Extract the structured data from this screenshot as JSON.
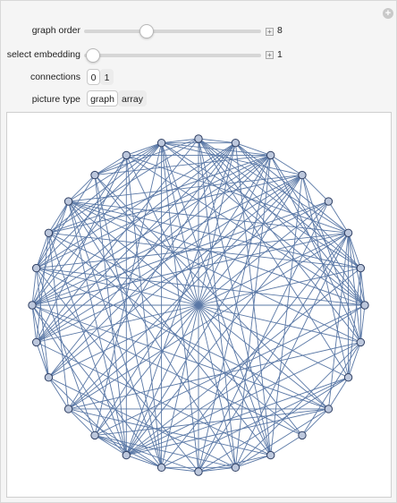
{
  "controls": {
    "graph_order": {
      "label": "graph order",
      "value": "8",
      "fraction": 0.43
    },
    "select_embedding": {
      "label": "select embedding",
      "value": "1",
      "fraction": 0.0
    },
    "connections": {
      "label": "connections",
      "options": [
        "0",
        "1"
      ],
      "selected": "0"
    },
    "picture_type": {
      "label": "picture type",
      "options": [
        "graph",
        "array"
      ],
      "selected": "graph"
    }
  },
  "graph": {
    "vertex_count": 28,
    "edge_color": "#5a78a6",
    "vertex_fill": "#bcc7dc",
    "vertex_stroke": "#2f3f63"
  },
  "colors": {
    "panel_background": "#f5f5f5",
    "plot_background": "#ffffff"
  }
}
